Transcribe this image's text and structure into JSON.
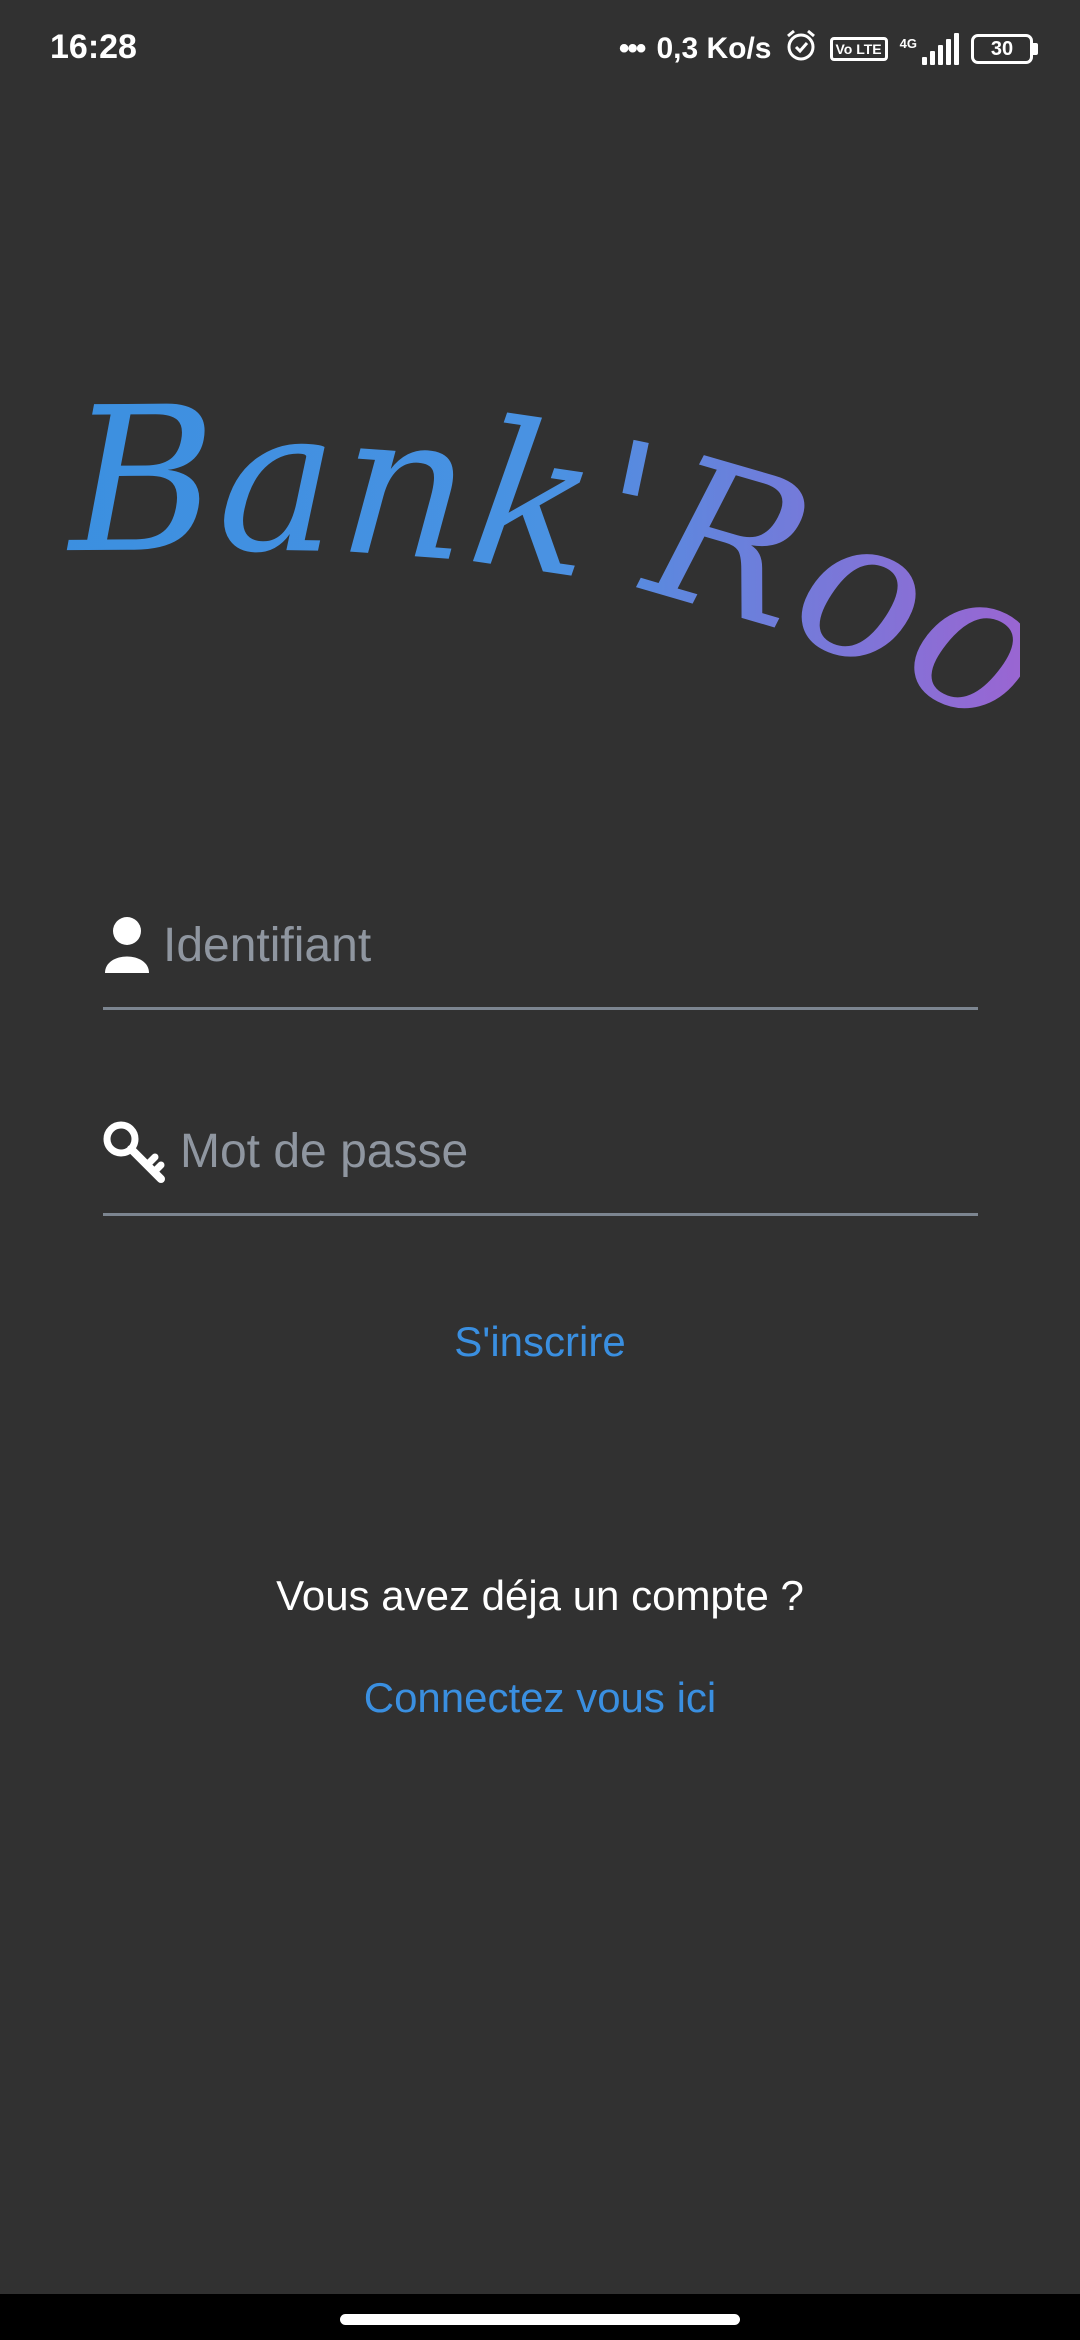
{
  "status_bar": {
    "time": "16:28",
    "speed": "0,3 Ko/s",
    "volte": "Vo LTE",
    "network": "4G",
    "battery": "30",
    "icons": [
      "alarm-icon",
      "volte-icon",
      "signal-icon",
      "battery-icon"
    ]
  },
  "logo": {
    "text": "Bank'Root",
    "colors": [
      "#3a8fe0",
      "#a55fd0"
    ]
  },
  "form": {
    "username_placeholder": "Identifiant",
    "password_placeholder": "Mot de passe",
    "username_value": "",
    "password_value": ""
  },
  "actions": {
    "signup_label": "S'inscrire",
    "have_account_text": "Vous avez déja un compte ?",
    "login_link_label": "Connectez vous ici"
  },
  "colors": {
    "background": "#313131",
    "accent": "#3a8fe0",
    "underline": "#7c8590"
  }
}
